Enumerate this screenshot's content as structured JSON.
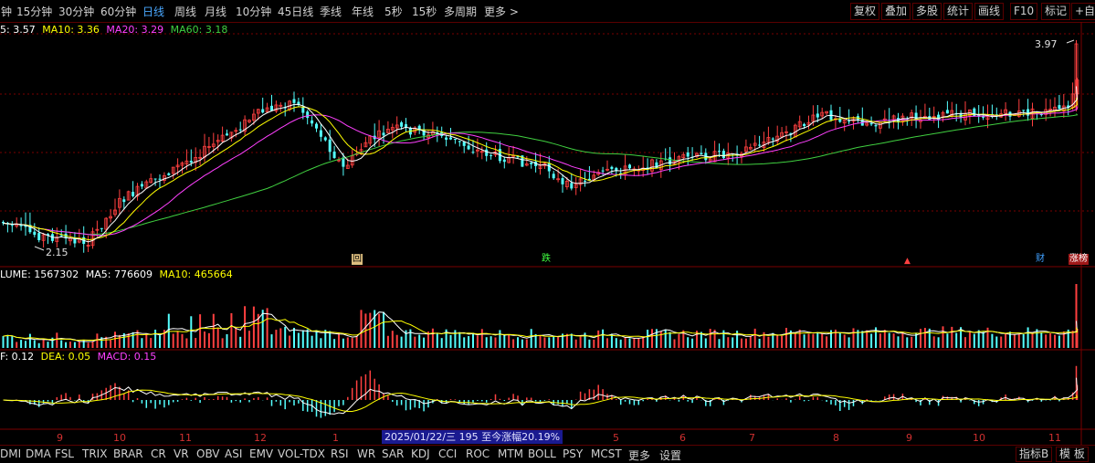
{
  "periods": [
    "钟",
    "15分钟",
    "30分钟",
    "60分钟",
    "日线",
    "周线",
    "月线",
    "10分钟",
    "45日线",
    "季线",
    "年线",
    "5秒",
    "15秒",
    "多周期",
    "更多 >"
  ],
  "active_period": "日线",
  "tools": [
    "复权",
    "叠加",
    "多股",
    "统计",
    "画线",
    "F10",
    "标记",
    "+自选"
  ],
  "main_legend": {
    "ma5": "5: 3.57",
    "ma10": "MA10: 3.36",
    "ma20": "MA20: 3.29",
    "ma60": "MA60: 3.18"
  },
  "volume_legend": {
    "vol": "LUME: 1567302",
    "ma5": "MA5: 776609",
    "ma10": "MA10: 465664"
  },
  "macd_legend": {
    "dif": "F: 0.12",
    "dea": "DEA: 0.05",
    "macd": "MACD: 0.15"
  },
  "high_label": "3.97",
  "low_label": "2.15",
  "markers": {
    "hui": "回",
    "die": "跌",
    "cai": "财",
    "zhangbang": "涨榜"
  },
  "months": [
    "9",
    "10",
    "11",
    "12",
    "1",
    "5",
    "6",
    "7",
    "8",
    "9",
    "10",
    "11"
  ],
  "date_info": "2025/01/22/三 195 至今涨幅20.19%",
  "indicators": [
    "DMI",
    "DMA",
    "FSL",
    "TRIX",
    "BRAR",
    "CR",
    "VR",
    "OBV",
    "ASI",
    "EMV",
    "VOL-TDX",
    "RSI",
    "WR",
    "SAR",
    "KDJ",
    "CCI",
    "ROC",
    "MTM",
    "BOLL",
    "PSY",
    "MCST",
    "更多",
    "设置"
  ],
  "indicator_right": [
    "指标B",
    "模 板"
  ],
  "colors": {
    "up": "#ff4040",
    "down": "#54ffff",
    "ma5": "#ffffff",
    "ma10": "#ffff00",
    "ma20": "#ff40ff",
    "ma60": "#40d040",
    "grid": "#7a0000",
    "accent": "#4aa8ff"
  },
  "chart_data": {
    "type": "candlestick",
    "price_high": 3.97,
    "price_low": 2.15,
    "series": [
      {
        "name": "MA5",
        "value": 3.57
      },
      {
        "name": "MA10",
        "value": 3.36
      },
      {
        "name": "MA20",
        "value": 3.29
      },
      {
        "name": "MA60",
        "value": 3.18
      }
    ],
    "volume": {
      "VOLUME": 1567302,
      "MA5": 776609,
      "MA10": 465664
    },
    "macd": {
      "DIF": 0.12,
      "DEA": 0.05,
      "MACD": 0.15
    },
    "x_ticks": [
      "9",
      "10",
      "11",
      "12",
      "1",
      "5",
      "6",
      "7",
      "8",
      "9",
      "10",
      "11"
    ]
  }
}
